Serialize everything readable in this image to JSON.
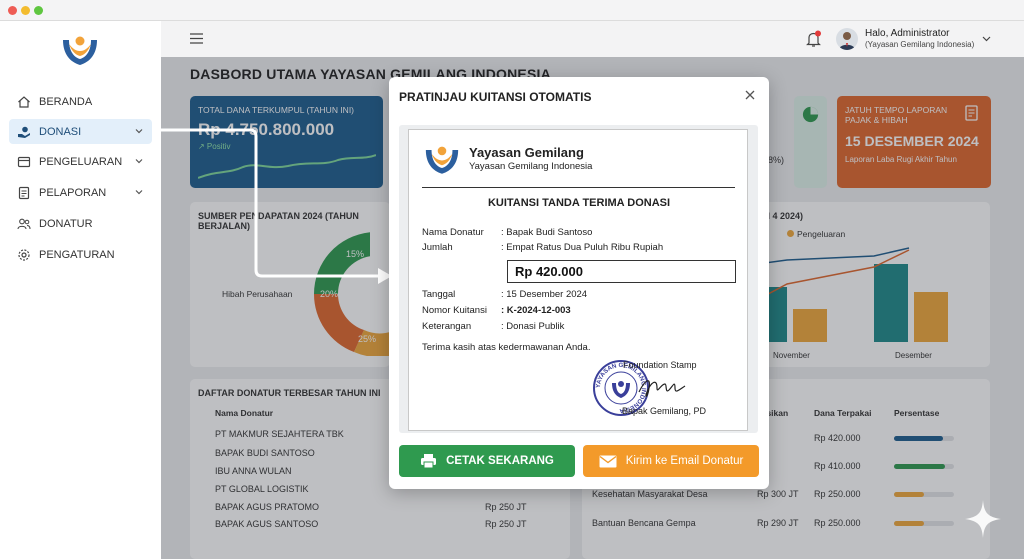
{
  "sidebar": {
    "items": [
      {
        "label": "BERANDA",
        "icon": "home-icon"
      },
      {
        "label": "DONASI",
        "icon": "donation-hand-icon"
      },
      {
        "label": "PENGELUARAN",
        "icon": "expense-icon"
      },
      {
        "label": "PELAPORAN",
        "icon": "report-icon"
      },
      {
        "label": "DONATUR",
        "icon": "users-icon"
      },
      {
        "label": "PENGATURAN",
        "icon": "gear-icon"
      }
    ]
  },
  "header": {
    "greeting": "Halo, Administrator",
    "org": "(Yayasan Gemilang Indonesia)"
  },
  "dashboard": {
    "title": "DASBORD UTAMA YAYASAN GEMILANG INDONESIA",
    "card_total": {
      "label": "TOTAL DANA TERKUMPUL (TAHUN INI)",
      "value": "Rp 4.750.800.000",
      "trend": "↗ Positiv"
    },
    "card_partial": {
      "text": "(8%)"
    },
    "card_due": {
      "label": "JATUH TEMPO LAPORAN PAJAK & HIBAH",
      "value": "15 DESEMBER 2024",
      "sub": "Laporan Laba Rugi Akhir Tahun"
    },
    "income_panel": {
      "title": "SUMBER PENDAPATAN 2024 (TAHUN BERJALAN)",
      "legend_item": "Hibah Perusahaan",
      "slices": [
        "15%",
        "20%",
        "25%"
      ]
    },
    "trend_panel": {
      "title_fragment": "AN 4 2024)",
      "legend_expense": "Pengeluaran",
      "x_labels": [
        "November",
        "Desember"
      ]
    },
    "donor_table": {
      "title": "DAFTAR DONATUR TERBESAR TAHUN INI",
      "col_name": "Nama Donatur",
      "rows": [
        {
          "name": "PT MAKMUR SEJAHTERA TBK",
          "amount": ""
        },
        {
          "name": "BAPAK BUDI SANTOSO",
          "amount": ""
        },
        {
          "name": "IBU ANNA WULAN",
          "amount": ""
        },
        {
          "name": "PT GLOBAL LOGISTIK",
          "amount": ""
        },
        {
          "name": "BAPAK AGUS PRATOMO",
          "amount": "Rp 250 JT"
        },
        {
          "name": "BAPAK AGUS SANTOSO",
          "amount": "Rp 250 JT"
        }
      ]
    },
    "alloc_table": {
      "col_alloc": "kasikan",
      "col_used": "Dana Terpakai",
      "col_pct": "Persentase",
      "rows": [
        {
          "program": "",
          "alloc": "",
          "used": "Rp 420.000",
          "pct": 0.82,
          "color": "#1d5d8f"
        },
        {
          "program": "",
          "alloc": "",
          "used": "Rp 410.000",
          "pct": 0.85,
          "color": "#2f9a4f"
        },
        {
          "program": "Kesehatan Masyarakat Desa",
          "alloc": "Rp 300 JT",
          "used": "Rp 250.000",
          "pct": 0.5,
          "color": "#f0a83c"
        },
        {
          "program": "Bantuan Bencana Gempa",
          "alloc": "Rp 290 JT",
          "used": "Rp 250.000",
          "pct": 0.5,
          "color": "#f0a83c"
        }
      ]
    }
  },
  "modal": {
    "title": "PRATINJAU KUITANSI OTOMATIS",
    "receipt": {
      "org_name": "Yayasan Gemilang",
      "org_sub": "Yayasan Gemilang Indonesia",
      "heading": "KUITANSI TANDA TERIMA DONASI",
      "donor_label": "Nama Donatur",
      "donor_value": ": Bapak Budi Santoso",
      "amount_words_label": "Jumlah",
      "amount_words_value": ": Empat Ratus Dua Puluh Ribu Rupiah",
      "amount": "Rp 420.000",
      "date_label": "Tanggal",
      "date_value": ": 15 Desember 2024",
      "number_label": "Nomor Kuitansi",
      "number_value": ": K-2024-12-003",
      "note_label": "Keterangan",
      "note_value": ": Donasi Publik",
      "thanks": "Terima kasih atas kedermawanan Anda.",
      "stamp_label": "Foundation Stamp",
      "stamp_ring_text": "YAYASAN GEMILANG INDONESIA",
      "signer": "Bapak Gemilang, PD"
    },
    "print_label": "CETAK SEKARANG",
    "email_label": "Kirim ke Email Donatur"
  }
}
